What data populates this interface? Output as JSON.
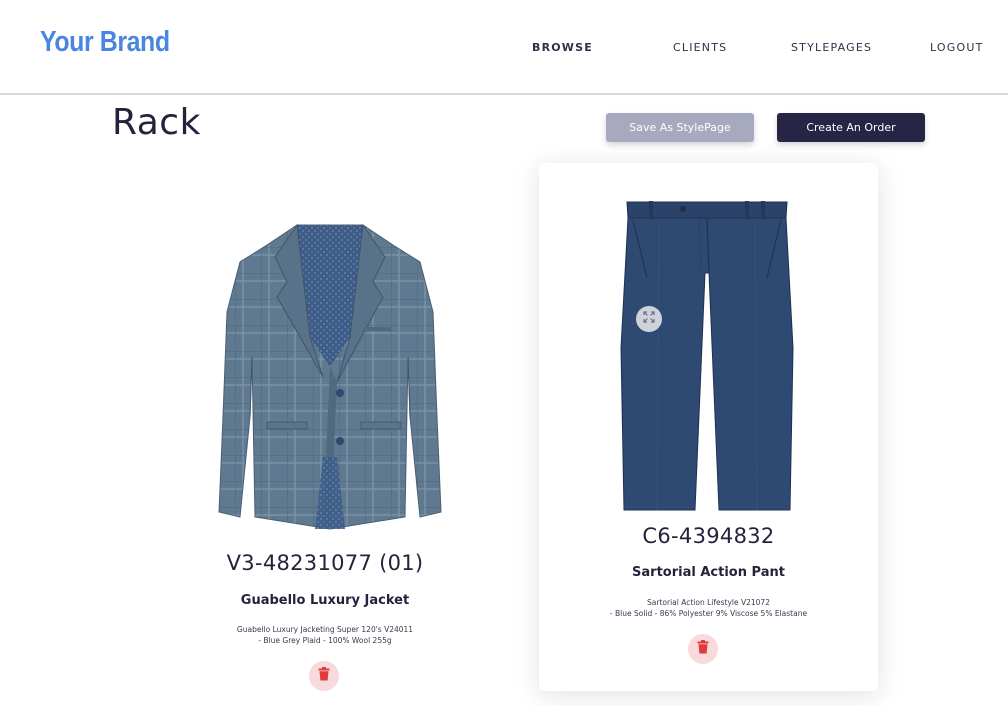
{
  "brand": {
    "name": "Your Brand",
    "color": "#4a86e0"
  },
  "nav": {
    "browse": "BROWSE",
    "clients": "CLIENTS",
    "stylepages": "STYLEPAGES",
    "logout": "LOGOUT"
  },
  "page": {
    "title": "Rack"
  },
  "actions": {
    "save_label": "Save As StylePage",
    "create_label": "Create An Order"
  },
  "products": [
    {
      "code": "V3-48231077 (01)",
      "name": "Guabello Luxury Jacket",
      "desc_line1": "Guabello Luxury Jacketing Super 120's V24011",
      "desc_line2": "- Blue Grey Plaid - 100% Wool 255g",
      "image": "grey-plaid-jacket",
      "delete_icon": "trash-icon"
    },
    {
      "code": "C6-4394832",
      "name": "Sartorial Action Pant",
      "desc_line1": "Sartorial Action Lifestyle V21072",
      "desc_line2": "- Blue Solid - 86% Polyester 9% Viscose 5% Elastane",
      "image": "navy-trousers",
      "delete_icon": "trash-icon",
      "expand_icon": "expand-icon"
    }
  ],
  "colors": {
    "primary_dark": "#262545",
    "secondary_button": "#a7a9be",
    "delete_red": "#e03a3f",
    "delete_bg": "#f8d9dc"
  }
}
